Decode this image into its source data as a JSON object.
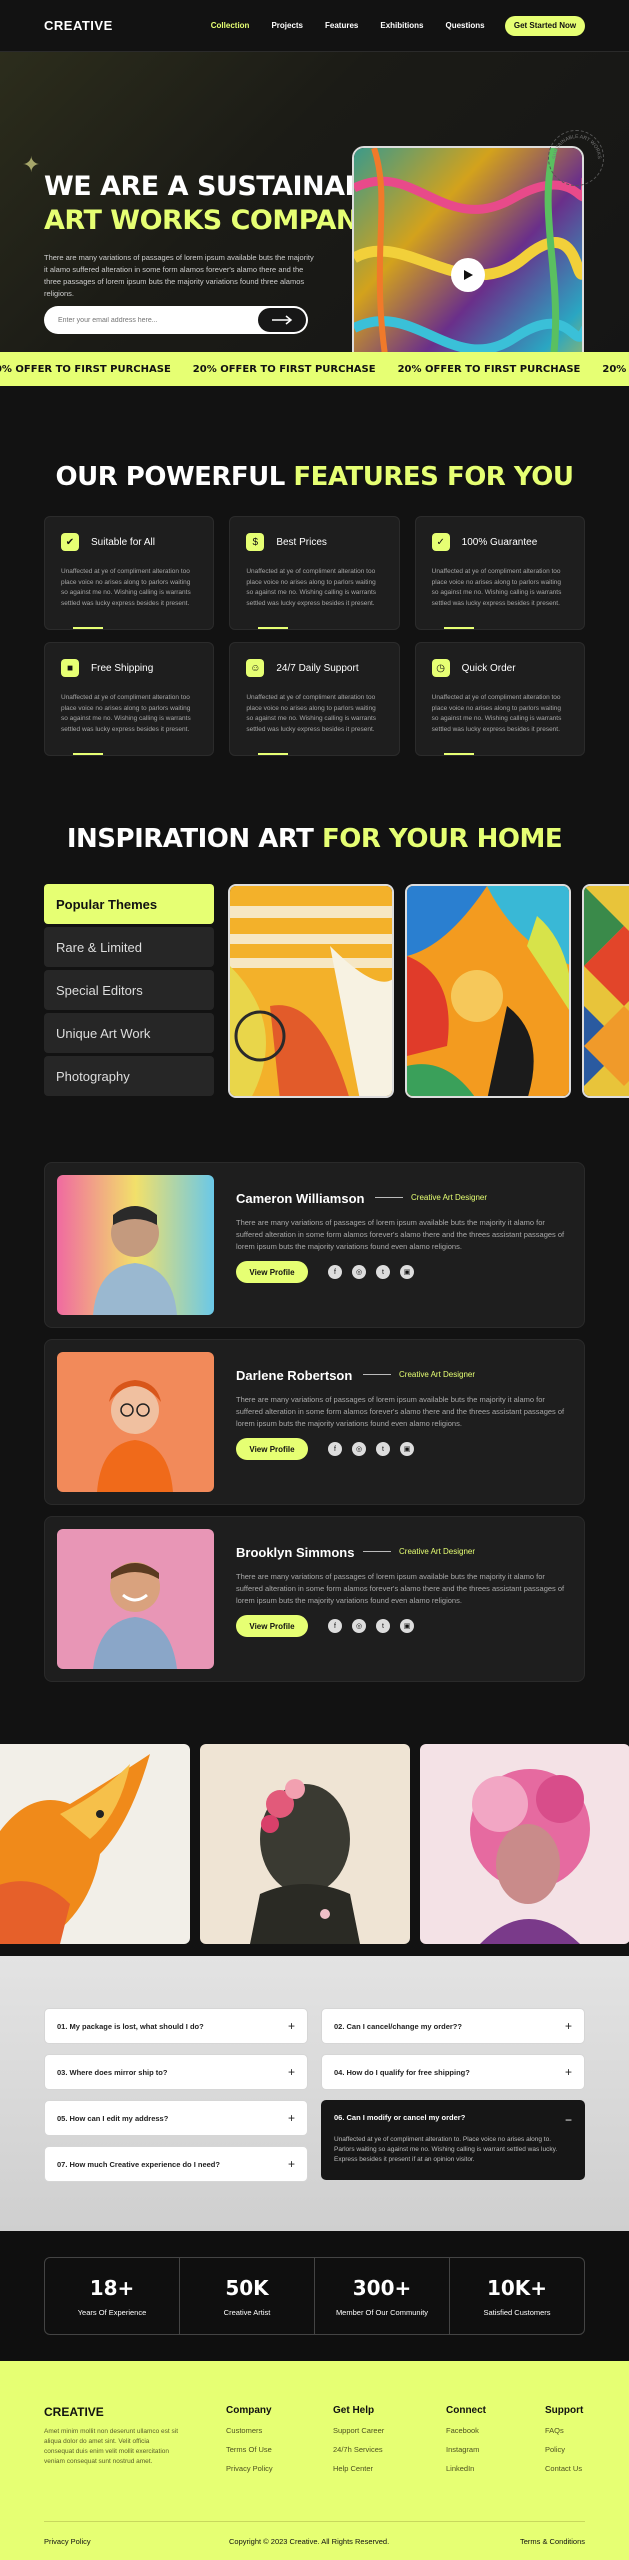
{
  "header": {
    "logo": "CREATIVE",
    "nav": [
      "Collection",
      "Projects",
      "Features",
      "Exhibitions",
      "Questions"
    ],
    "cta": "Get Started Now"
  },
  "hero": {
    "title1": "WE ARE A SUSTAINABLE",
    "title2": "ART WORKS COMPANY",
    "desc": "There are many variations of passages of lorem ipsum available buts the majority it alamo suffered alteration in some form alamos forever's alamo there and the three passages of lorem ipsum buts the majority variations found three alamos religions.",
    "email_placeholder": "Enter your email address here...",
    "badge": "SUSTAINABLE ART WORKS"
  },
  "ticker": {
    "text": "20% OFFER TO FIRST PURCHASE"
  },
  "features": {
    "title_white": "OUR POWERFUL ",
    "title_yellow": "FEATURES FOR YOU",
    "items": [
      {
        "icon": "thumb-icon",
        "glyph": "✔",
        "title": "Suitable for All"
      },
      {
        "icon": "dollar-icon",
        "glyph": "$",
        "title": "Best Prices"
      },
      {
        "icon": "shield-icon",
        "glyph": "✓",
        "title": "100% Guarantee"
      },
      {
        "icon": "truck-icon",
        "glyph": "■",
        "title": "Free Shipping"
      },
      {
        "icon": "support-icon",
        "glyph": "☺",
        "title": "24/7 Daily Support"
      },
      {
        "icon": "clock-icon",
        "glyph": "◷",
        "title": "Quick Order"
      }
    ],
    "desc": "Unaffected at ye of compliment alteration too place voice no arises along to parlors waiting so against me no. Wishing calling is warrants settled was lucky express besides it present."
  },
  "inspiration": {
    "title_white": "INSPIRATION ART ",
    "title_yellow": "FOR YOUR HOME",
    "tabs": [
      "Popular Themes",
      "Rare & Limited",
      "Special Editors",
      "Unique Art Work",
      "Photography"
    ]
  },
  "people": {
    "button": "View Profile",
    "desc": "There are many variations of passages of lorem ipsum available buts the majority it alamo for suffered alteration in some form alamos forever's alamo there and the threes assistant passages of lorem ipsum buts the majority variations found even alamo religions.",
    "items": [
      {
        "name": "Cameron Williamson",
        "role": "Creative Art Designer"
      },
      {
        "name": "Darlene Robertson",
        "role": "Creative Art Designer"
      },
      {
        "name": "Brooklyn Simmons",
        "role": "Creative Art Designer"
      }
    ]
  },
  "faq": {
    "items": [
      {
        "q": "01.   My package is lost, what should I do?"
      },
      {
        "q": "02.   Can I cancel/change my order??"
      },
      {
        "q": "03.   Where does mirror ship to?"
      },
      {
        "q": "04.   How do I qualify for free shipping?"
      },
      {
        "q": "05.   How can I edit my address?"
      },
      {
        "q": "06.   Can I modify or cancel my order?",
        "a": "Unaffected at ye of compliment alteration to. Place voice no arises along to. Parlors waiting so against me no. Wishing calling is warrant settled was lucky. Express besides it present if at an opinion visitor."
      },
      {
        "q": "07.   How much Creative experience do I need?"
      }
    ]
  },
  "stats": [
    {
      "value": "18+",
      "label": "Years Of Experience"
    },
    {
      "value": "50K",
      "label": "Creative Artist"
    },
    {
      "value": "300+",
      "label": "Member Of Our Community"
    },
    {
      "value": "10K+",
      "label": "Satisfied Customers"
    }
  ],
  "footer": {
    "logo": "CREATIVE",
    "desc": "Amet minim mollit non deserunt ullamco est sit aliqua dolor do amet sint. Velit officia consequat duis enim velit mollit exercitation veniam consequat sunt nostrud amet.",
    "cols": [
      {
        "title": "Company",
        "links": [
          "Customers",
          "Terms Of Use",
          "Privacy Policy"
        ]
      },
      {
        "title": "Get Help",
        "links": [
          "Support Career",
          "24/7h Services",
          "Help Center"
        ]
      },
      {
        "title": "Connect",
        "links": [
          "Facebook",
          "Instagram",
          "LinkedIn"
        ]
      },
      {
        "title": "Support",
        "links": [
          "FAQs",
          "Policy",
          "Contact Us"
        ]
      }
    ],
    "privacy": "Privacy Policy",
    "copyright": "Copyright © 2023 Creative. All Rights Reserved.",
    "terms": "Terms & Conditions"
  }
}
